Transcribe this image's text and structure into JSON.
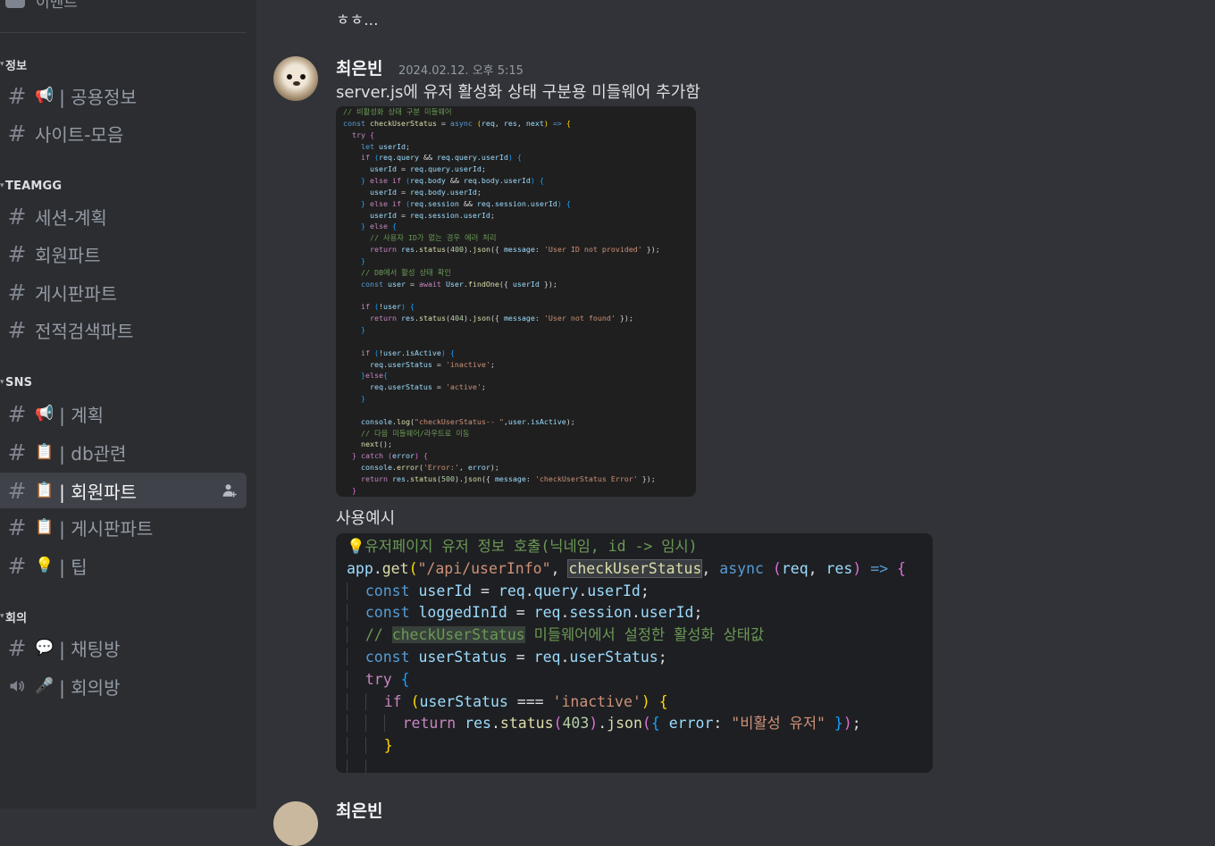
{
  "sidebar": {
    "top_item": "이벤트",
    "categories": [
      {
        "name": "정보"
      },
      {
        "name": "TEAMGG"
      },
      {
        "name": "SNS"
      },
      {
        "name": "회의"
      }
    ],
    "channels": {
      "public_info": {
        "emoji": "📢",
        "label": "| 공용정보"
      },
      "site_collection": {
        "label": "사이트-모음"
      },
      "session_plan": {
        "label": "세션-계획"
      },
      "member_part": {
        "label": "회원파트"
      },
      "board_part": {
        "label": "게시판파트"
      },
      "record_search_part": {
        "label": "전적검색파트"
      },
      "sns_plan": {
        "emoji": "📢",
        "label": "| 계획"
      },
      "db_related": {
        "emoji": "📋",
        "label": "| db관련"
      },
      "sns_member_part": {
        "emoji": "📋",
        "label": "| 회원파트"
      },
      "sns_board_part": {
        "emoji": "📋",
        "label": "| 게시판파트"
      },
      "tips": {
        "emoji": "💡",
        "label": "| 팁"
      },
      "chat_room": {
        "emoji": "💬",
        "label": "| 채팅방"
      },
      "meeting_room": {
        "emoji": "🎤",
        "label": "| 회의방"
      }
    }
  },
  "main": {
    "prev_text": "ㅎㅎ...",
    "message": {
      "author": "최은빈",
      "timestamp": "2024.02.12. 오후 5:15",
      "text": "server.js에 유저 활성화 상태 구분용 미들웨어 추가함",
      "text2": "사용예시"
    },
    "next_author": "최은빈"
  },
  "code_image": {
    "comment": "// 비활성화 상태 구분 미들웨어"
  },
  "code_block": {
    "line1_comment": "💡유저페이지 유저 정보 호출(닉네임, id -> 임시)",
    "route": "\"/api/userInfo\"",
    "middleware": "checkUserStatus",
    "comment_prefix": "// ",
    "comment_suffix": " 미들웨어에서 설정한 활성화 상태값",
    "inactive": "'inactive'",
    "error_msg": "\"비활성 유저\""
  },
  "colors": {
    "bg_main": "#313338",
    "bg_sidebar": "#2b2d31",
    "active_channel": "#404249"
  }
}
